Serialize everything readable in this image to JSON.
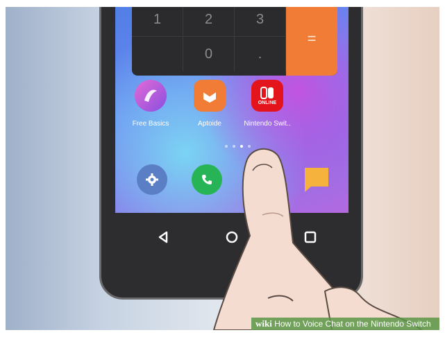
{
  "calculator": {
    "keys_row1": [
      "1",
      "2",
      "3"
    ],
    "keys_row2": [
      "",
      "0",
      "."
    ],
    "equals": "=",
    "accent_color": "#f17c35"
  },
  "home_apps": [
    {
      "label": "Free Basics",
      "icon": "free-basics-icon"
    },
    {
      "label": "Aptoide",
      "icon": "aptoide-icon"
    },
    {
      "label": "Nintendo Swit..",
      "icon": "nintendo-switch-online-icon",
      "badge_text": "ONLINE"
    }
  ],
  "page_indicator": {
    "count": 4,
    "active_index": 2
  },
  "dock": [
    {
      "icon": "settings-icon",
      "color": "#5a7fc4"
    },
    {
      "icon": "phone-icon",
      "color": "#27b457"
    },
    {
      "icon": "messages-icon",
      "color": "#f5b23d"
    }
  ],
  "navbar": {
    "back": "back-icon",
    "home": "home-icon",
    "recents": "recents-icon"
  },
  "watermark": {
    "brand": "wiki",
    "title": "How to Voice Chat on the Nintendo Switch"
  }
}
